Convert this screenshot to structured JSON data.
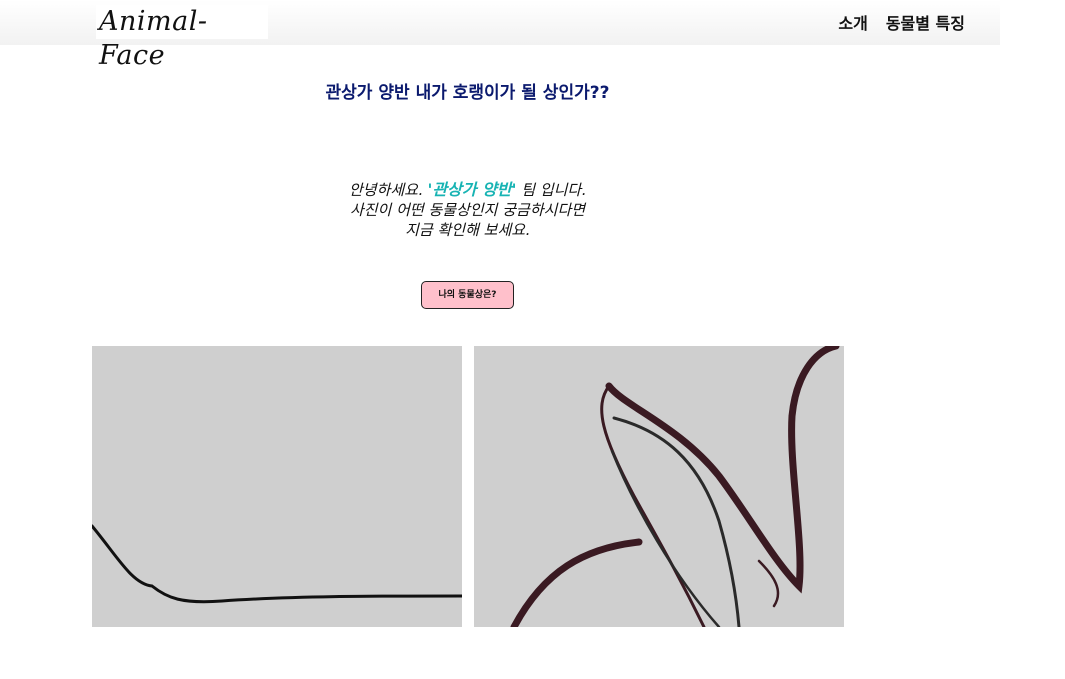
{
  "navbar": {
    "logo": "Animal-Face",
    "links": [
      "소개",
      "동물별 특징"
    ]
  },
  "headline": "관상가 양반 내가 호랭이가 될 상인가??",
  "intro": {
    "line1_before": "안녕하세요. ",
    "brand": "'관상가 양반'",
    "line1_after": " 팀 입니다.",
    "line2": "사진이 어떤 동물상인지 궁금하시다면",
    "line3": "지금 확인해 보세요."
  },
  "cta_button": "나의 동물상은?",
  "colors": {
    "headline": "#0b1a6e",
    "brand": "#17b3b3",
    "button_bg": "#ffc0cb",
    "panel_bg": "#cfcfcf",
    "stroke_dark": "#3a1a22"
  }
}
